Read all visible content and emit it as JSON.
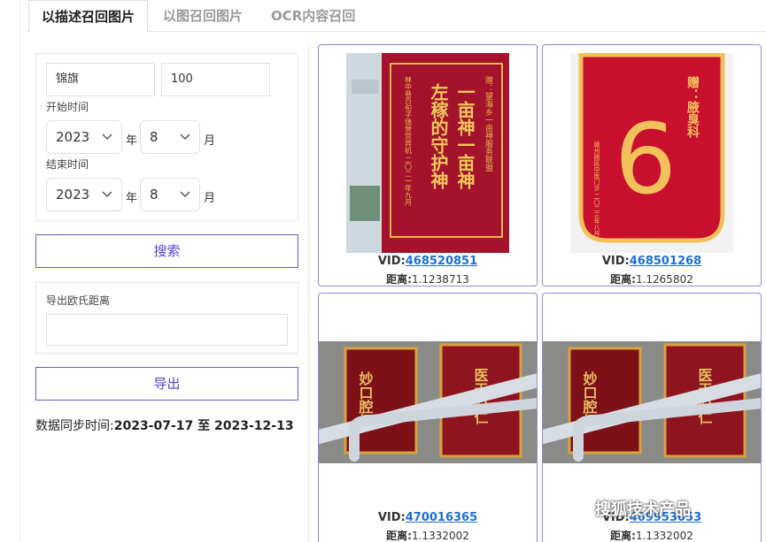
{
  "tabs": [
    {
      "label": "以描述召回图片",
      "active": true
    },
    {
      "label": "以图召回图片",
      "active": false
    },
    {
      "label": "OCR内容召回",
      "active": false
    }
  ],
  "search": {
    "query": "锦旗",
    "count": "100",
    "start_label": "开始时间",
    "start_year": "2023",
    "start_month": "8",
    "end_label": "结束时间",
    "end_year": "2023",
    "end_month": "8",
    "year_unit": "年",
    "month_unit": "月",
    "search_button": "搜索"
  },
  "export": {
    "label": "导出欧氏距离",
    "value": "",
    "button": "导出"
  },
  "sync": {
    "prefix": "数据同步时间:",
    "range": "2023-07-17 至 2023-12-13"
  },
  "results": [
    {
      "vid_label": "VID:",
      "vid": "468520851",
      "dist_label": "距离:",
      "dist": "1.1238713",
      "banner": {
        "to": "赠：望海乡一亩神服务联盟",
        "line1": "一亩神一亩神",
        "line2": "左稼的守护神",
        "from": "林中巷百旬子镇营宫宾机 二〇二一年九月"
      }
    },
    {
      "vid_label": "VID:",
      "vid": "468501268",
      "dist_label": "距离:",
      "dist": "1.1265802",
      "banner": {
        "big": "6",
        "to": "赠：腋臭科",
        "from": "赣州刚民中医门诊 二〇二三年八月"
      }
    },
    {
      "vid_label": "VID:",
      "vid": "470016365",
      "dist_label": "距离:",
      "dist": "1.1332002",
      "banner": {
        "left": "妙口腔杨",
        "right": "医天心仁"
      }
    },
    {
      "vid_label": "VID:",
      "vid": "469953053",
      "dist_label": "距离:",
      "dist": "1.1332002",
      "banner": {
        "left": "妙口腔杨",
        "right": "医天心仁"
      }
    }
  ],
  "watermark": "搜狐技术产品",
  "colors": {
    "accent": "#5b3fd4",
    "link": "#1e6fd9",
    "banner_red": "#b0102a",
    "gold": "#e8b84a"
  }
}
